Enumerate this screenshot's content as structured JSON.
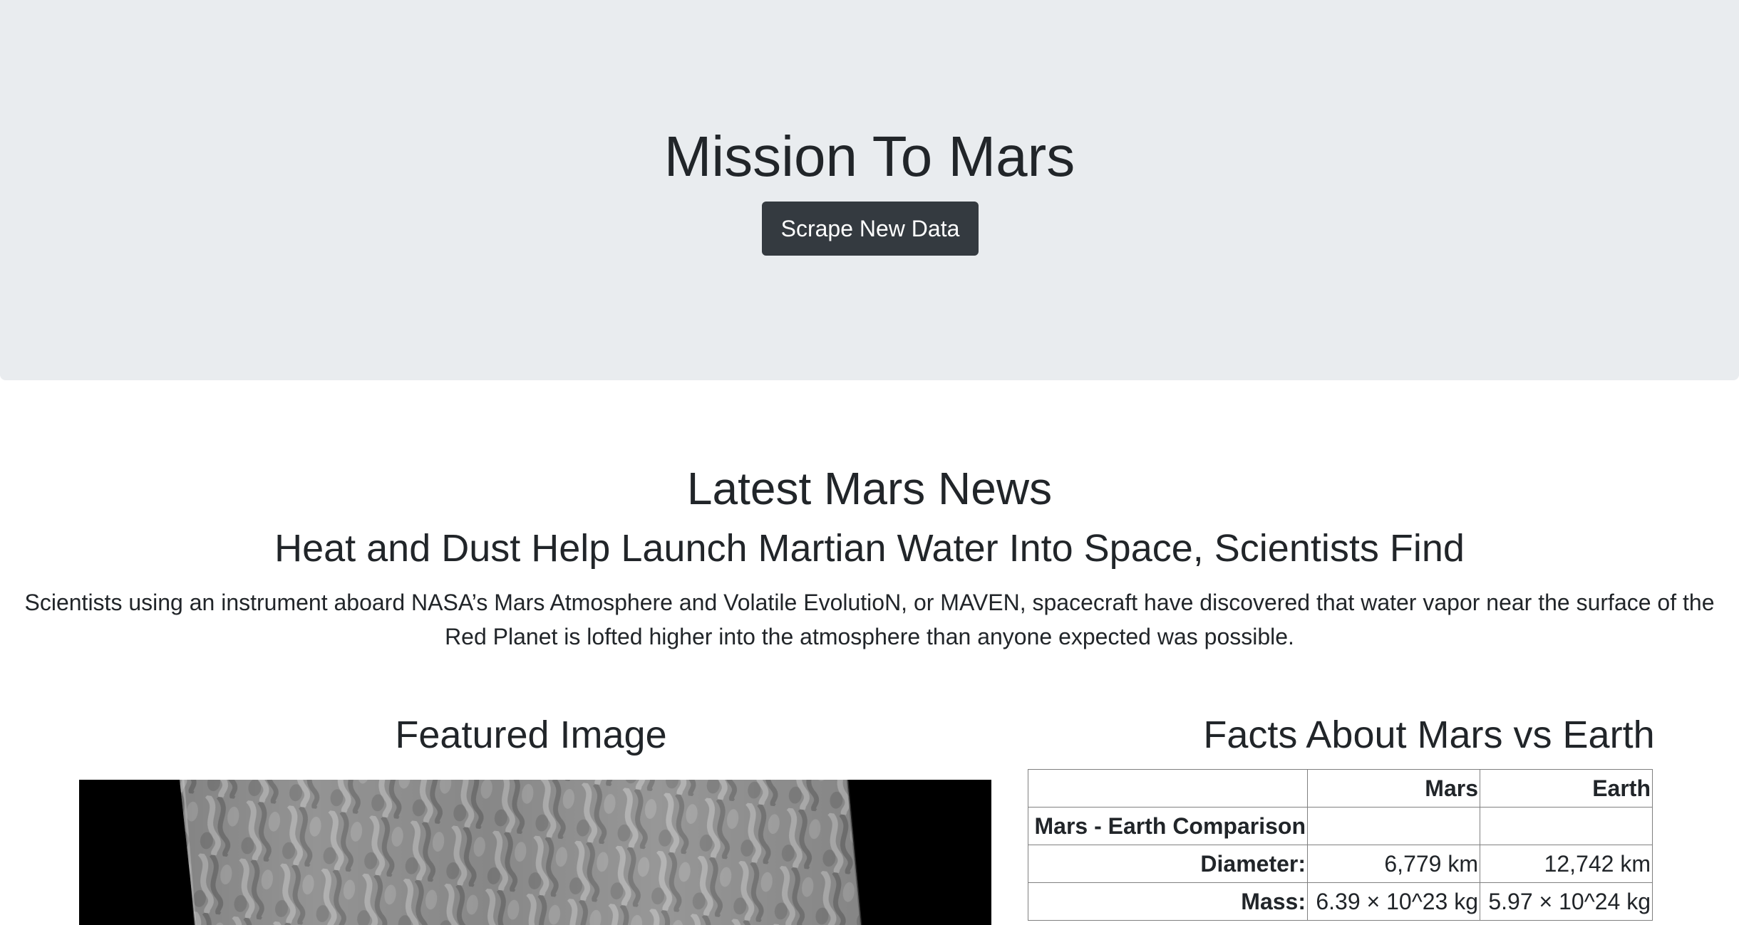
{
  "jumbotron": {
    "title": "Mission To Mars",
    "button_label": "Scrape New Data"
  },
  "news": {
    "section_title": "Latest Mars News",
    "headline": "Heat and Dust Help Launch Martian Water Into Space, Scientists Find",
    "paragraph": "Scientists using an instrument aboard NASA’s Mars Atmosphere and Volatile EvolutioN, or MAVEN, spacecraft have discovered that water vapor near the surface of the Red Planet is lofted higher into the atmosphere than anyone expected was possible."
  },
  "featured": {
    "title": "Featured Image",
    "image_description": "grayscale Mars dune terrain"
  },
  "facts": {
    "title": "Facts About Mars vs Earth",
    "columns": [
      "",
      "Mars",
      "Earth"
    ],
    "rows": [
      {
        "label": "Mars - Earth Comparison",
        "mars": "",
        "earth": ""
      },
      {
        "label": "Diameter:",
        "mars": "6,779 km",
        "earth": "12,742 km"
      },
      {
        "label": "Mass:",
        "mars": "6.39 × 10^23 kg",
        "earth": "5.97 × 10^24 kg"
      }
    ]
  },
  "colors": {
    "jumbotron_bg": "#e9ecef",
    "button_bg": "#343a40",
    "text": "#212529",
    "table_border": "#808080"
  }
}
